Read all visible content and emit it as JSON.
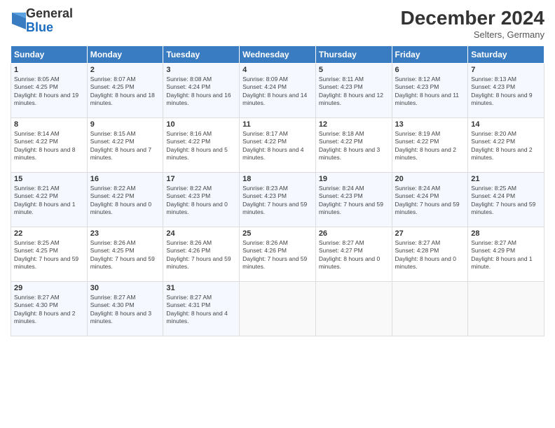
{
  "header": {
    "logo_general": "General",
    "logo_blue": "Blue",
    "month_title": "December 2024",
    "subtitle": "Selters, Germany"
  },
  "days_of_week": [
    "Sunday",
    "Monday",
    "Tuesday",
    "Wednesday",
    "Thursday",
    "Friday",
    "Saturday"
  ],
  "weeks": [
    [
      {
        "day": 1,
        "sunrise": "8:05 AM",
        "sunset": "4:25 PM",
        "daylight": "8 hours and 19 minutes"
      },
      {
        "day": 2,
        "sunrise": "8:07 AM",
        "sunset": "4:25 PM",
        "daylight": "8 hours and 18 minutes"
      },
      {
        "day": 3,
        "sunrise": "8:08 AM",
        "sunset": "4:24 PM",
        "daylight": "8 hours and 16 minutes"
      },
      {
        "day": 4,
        "sunrise": "8:09 AM",
        "sunset": "4:24 PM",
        "daylight": "8 hours and 14 minutes"
      },
      {
        "day": 5,
        "sunrise": "8:11 AM",
        "sunset": "4:23 PM",
        "daylight": "8 hours and 12 minutes"
      },
      {
        "day": 6,
        "sunrise": "8:12 AM",
        "sunset": "4:23 PM",
        "daylight": "8 hours and 11 minutes"
      },
      {
        "day": 7,
        "sunrise": "8:13 AM",
        "sunset": "4:23 PM",
        "daylight": "8 hours and 9 minutes"
      }
    ],
    [
      {
        "day": 8,
        "sunrise": "8:14 AM",
        "sunset": "4:22 PM",
        "daylight": "8 hours and 8 minutes"
      },
      {
        "day": 9,
        "sunrise": "8:15 AM",
        "sunset": "4:22 PM",
        "daylight": "8 hours and 7 minutes"
      },
      {
        "day": 10,
        "sunrise": "8:16 AM",
        "sunset": "4:22 PM",
        "daylight": "8 hours and 5 minutes"
      },
      {
        "day": 11,
        "sunrise": "8:17 AM",
        "sunset": "4:22 PM",
        "daylight": "8 hours and 4 minutes"
      },
      {
        "day": 12,
        "sunrise": "8:18 AM",
        "sunset": "4:22 PM",
        "daylight": "8 hours and 3 minutes"
      },
      {
        "day": 13,
        "sunrise": "8:19 AM",
        "sunset": "4:22 PM",
        "daylight": "8 hours and 2 minutes"
      },
      {
        "day": 14,
        "sunrise": "8:20 AM",
        "sunset": "4:22 PM",
        "daylight": "8 hours and 2 minutes"
      }
    ],
    [
      {
        "day": 15,
        "sunrise": "8:21 AM",
        "sunset": "4:22 PM",
        "daylight": "8 hours and 1 minute"
      },
      {
        "day": 16,
        "sunrise": "8:22 AM",
        "sunset": "4:22 PM",
        "daylight": "8 hours and 0 minutes"
      },
      {
        "day": 17,
        "sunrise": "8:22 AM",
        "sunset": "4:23 PM",
        "daylight": "8 hours and 0 minutes"
      },
      {
        "day": 18,
        "sunrise": "8:23 AM",
        "sunset": "4:23 PM",
        "daylight": "7 hours and 59 minutes"
      },
      {
        "day": 19,
        "sunrise": "8:24 AM",
        "sunset": "4:23 PM",
        "daylight": "7 hours and 59 minutes"
      },
      {
        "day": 20,
        "sunrise": "8:24 AM",
        "sunset": "4:24 PM",
        "daylight": "7 hours and 59 minutes"
      },
      {
        "day": 21,
        "sunrise": "8:25 AM",
        "sunset": "4:24 PM",
        "daylight": "7 hours and 59 minutes"
      }
    ],
    [
      {
        "day": 22,
        "sunrise": "8:25 AM",
        "sunset": "4:25 PM",
        "daylight": "7 hours and 59 minutes"
      },
      {
        "day": 23,
        "sunrise": "8:26 AM",
        "sunset": "4:25 PM",
        "daylight": "7 hours and 59 minutes"
      },
      {
        "day": 24,
        "sunrise": "8:26 AM",
        "sunset": "4:26 PM",
        "daylight": "7 hours and 59 minutes"
      },
      {
        "day": 25,
        "sunrise": "8:26 AM",
        "sunset": "4:26 PM",
        "daylight": "7 hours and 59 minutes"
      },
      {
        "day": 26,
        "sunrise": "8:27 AM",
        "sunset": "4:27 PM",
        "daylight": "8 hours and 0 minutes"
      },
      {
        "day": 27,
        "sunrise": "8:27 AM",
        "sunset": "4:28 PM",
        "daylight": "8 hours and 0 minutes"
      },
      {
        "day": 28,
        "sunrise": "8:27 AM",
        "sunset": "4:29 PM",
        "daylight": "8 hours and 1 minute"
      }
    ],
    [
      {
        "day": 29,
        "sunrise": "8:27 AM",
        "sunset": "4:30 PM",
        "daylight": "8 hours and 2 minutes"
      },
      {
        "day": 30,
        "sunrise": "8:27 AM",
        "sunset": "4:30 PM",
        "daylight": "8 hours and 3 minutes"
      },
      {
        "day": 31,
        "sunrise": "8:27 AM",
        "sunset": "4:31 PM",
        "daylight": "8 hours and 4 minutes"
      },
      null,
      null,
      null,
      null
    ]
  ]
}
